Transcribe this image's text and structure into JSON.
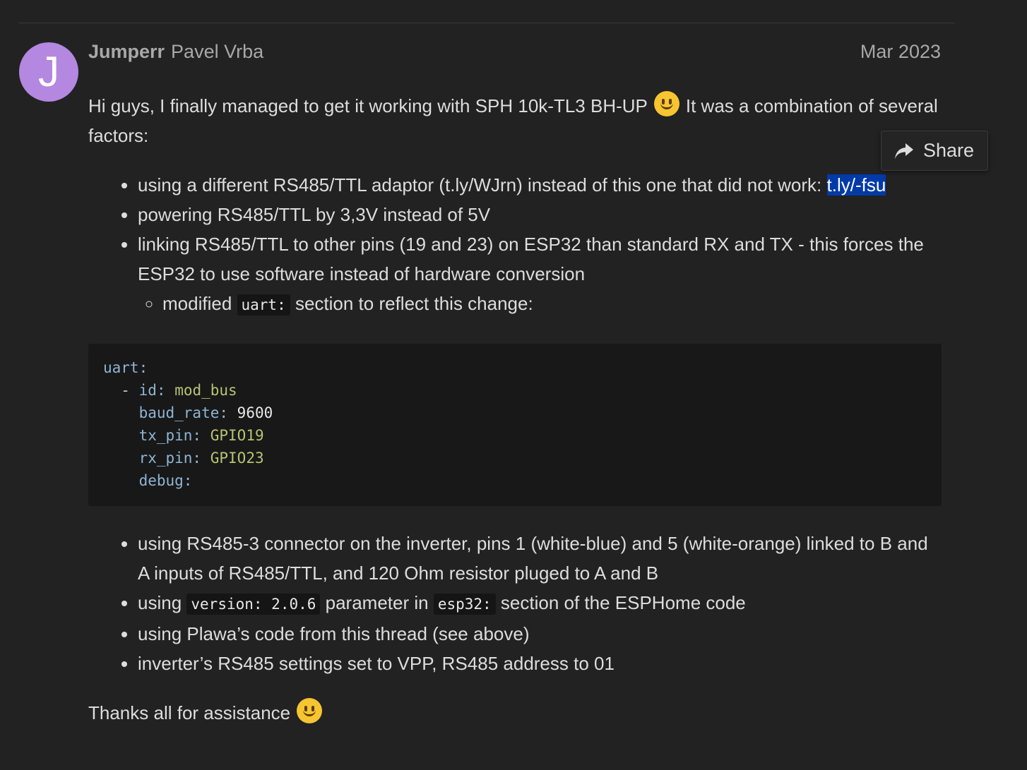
{
  "post": {
    "avatar_letter": "J",
    "avatar_color": "#b487e0",
    "username": "Jumperr",
    "full_name": "Pavel Vrba",
    "date": "Mar 2023",
    "intro_part1": "Hi guys, I finally managed to get it working with SPH 10k-TL3 BH-UP",
    "intro_part2": " It was a combination of several factors:",
    "intro_emoji": "slight-smile-emoji",
    "bullets1": {
      "b1_text": "using a different RS485/TTL adaptor (t.ly/WJrn) instead of this one that did not work: ",
      "b1_link": "t.ly/-fsu",
      "b2_text": "powering RS485/TTL by 3,3V instead of 5V",
      "b3_text": "linking RS485/TTL to other pins (19 and 23) on ESP32 than standard RX and TX - this forces the ESP32 to use software instead of hardware conversion",
      "sub1_pre": "modified ",
      "sub1_code": "uart:",
      "sub1_post": " section to reflect this change:"
    },
    "code_block": {
      "l1_key": "uart:",
      "l2_dash": "- ",
      "l2_key": "id:",
      "l2_val": "mod_bus",
      "l3_key": "baud_rate:",
      "l3_val": "9600",
      "l4_key": "tx_pin:",
      "l4_val": "GPIO19",
      "l5_key": "rx_pin:",
      "l5_val": "GPIO23",
      "l6_key": "debug:"
    },
    "bullets2": {
      "b4_text": "using RS485-3 connector on the inverter, pins 1 (white-blue) and 5 (white-orange) linked to B and A inputs of RS485/TTL, and 120 Ohm resistor pluged to A and B",
      "b5_pre": "using ",
      "b5_code1": "version: 2.0.6",
      "b5_mid": " parameter in ",
      "b5_code2": "esp32:",
      "b5_post": " section of the ESPHome code",
      "b6_text": "using Plawa’s code from this thread (see above)",
      "b7_text": "inverter’s RS485 settings set to VPP, RS485 address to 01"
    },
    "thanks_text": "Thanks all for assistance",
    "thanks_emoji": "slight-smile-emoji"
  },
  "share_popup": {
    "label": "Share",
    "icon": "share-arrow-icon"
  },
  "colors": {
    "background": "#222222",
    "text": "#dddddd",
    "link_selection": "#003aa8",
    "code_key": "#8fb5d3",
    "code_string": "#b7c372"
  }
}
